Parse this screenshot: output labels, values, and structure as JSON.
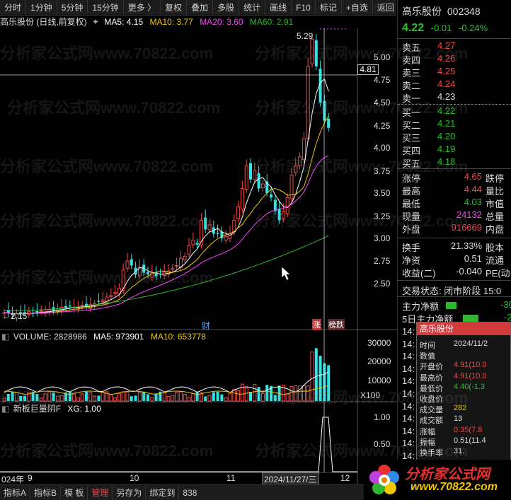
{
  "toolbar": {
    "items": [
      "分时",
      "1分钟",
      "5分钟",
      "15分钟",
      "更多 〉",
      "复权",
      "叠加",
      "多股",
      "统计",
      "画线",
      "F10",
      "标记",
      "+自选",
      "返回"
    ]
  },
  "chart_header": {
    "stock": "高乐股份 (日线,前复权)",
    "ma5": "MA5: 4.15",
    "ma10": "MA10: 3.77",
    "ma20": "MA20: 3.60",
    "ma60": "MA60: 2.91"
  },
  "price_axis": [
    "5.00",
    "4.75",
    "4.50",
    "4.25",
    "4.00",
    "3.75",
    "3.50",
    "3.25",
    "3.00",
    "2.75",
    "2.50"
  ],
  "annotations": {
    "high": "5.29",
    "low": "2.15",
    "crosshair_price": "4.81",
    "cai": "财",
    "zhang": "涨",
    "bang": "榜跌"
  },
  "volume_header": {
    "vol": "VOLUME: 2828986",
    "ma5": "MA5: 973901",
    "ma10": "MA10: 653778"
  },
  "volume_axis": [
    "30000",
    "20000",
    "10000"
  ],
  "volume_unit": "X100",
  "indicator_header": {
    "name": "新板巨量阴F",
    "xg": "XG: 1.00"
  },
  "indicator_axis": [
    "1.00",
    "0.50"
  ],
  "date_axis": {
    "d1": "024年",
    "d2": "9",
    "d3": "10",
    "d4": "11",
    "d5": "2024/11/27/三",
    "d6": "12"
  },
  "bottom_bar": [
    "指标A",
    "指标B",
    "模 板",
    "管理",
    "另存为",
    "绑定到",
    "838"
  ],
  "quote": {
    "name": "高乐股份",
    "code": "002348",
    "price": "4.22",
    "change": "-0.01",
    "pct": "-0.24%",
    "asks": [
      {
        "label": "卖五",
        "price": "4.27"
      },
      {
        "label": "卖四",
        "price": "4.26"
      },
      {
        "label": "卖三",
        "price": "4.25"
      },
      {
        "label": "卖二",
        "price": "4.24"
      },
      {
        "label": "卖一",
        "price": "4.23"
      }
    ],
    "bids": [
      {
        "label": "买一",
        "price": "4.22"
      },
      {
        "label": "买二",
        "price": "4.21"
      },
      {
        "label": "买三",
        "price": "4.20"
      },
      {
        "label": "买四",
        "price": "4.19"
      },
      {
        "label": "买五",
        "price": "4.18"
      }
    ],
    "stats": [
      {
        "l1": "涨停",
        "v1": "4.65",
        "l2": "跌停"
      },
      {
        "l1": "最高",
        "v1": "4.44",
        "l2": "量比"
      },
      {
        "l1": "最低",
        "v1": "4.03",
        "l2": "市值"
      },
      {
        "l1": "现量",
        "v1": "24132",
        "l2": "总量"
      },
      {
        "l1": "外盘",
        "v1": "916669",
        "l2": "内盘"
      }
    ],
    "stats2": [
      {
        "l1": "换手",
        "v1": "21.33%",
        "l2": "股本"
      },
      {
        "l1": "净资",
        "v1": "0.51",
        "l2": "流通"
      },
      {
        "l1": "收益(二)",
        "v1": "-0.040",
        "l2": "PE(动"
      }
    ],
    "trade_status_label": "交易状态:",
    "trade_status": "闭市阶段 15:0",
    "main_net": "主力净额",
    "main_net_val": "-30",
    "main_net5": "5日主力净额",
    "main_net5_val": "-2",
    "tick_times": [
      "14:",
      "14:",
      "14:",
      "14:",
      "14:",
      "14:",
      "14:",
      "14:",
      "14:",
      "14:",
      "14:",
      "14:",
      "14:",
      "14:",
      "14:"
    ]
  },
  "tooltip": {
    "title": "高乐股份",
    "rows": [
      {
        "k": "时间",
        "v": "2024/11/2"
      },
      {
        "k": "数值",
        "v": ""
      },
      {
        "k": "开盘价",
        "v": "4.91(10.0"
      },
      {
        "k": "最高价",
        "v": "4.91(10.0"
      },
      {
        "k": "最低价",
        "v": "4.40(-1.3"
      },
      {
        "k": "收盘价",
        "v": ""
      },
      {
        "k": "成交量",
        "v": "282"
      },
      {
        "k": "成交额",
        "v": "13"
      },
      {
        "k": "涨幅",
        "v": "0.35(7.8"
      },
      {
        "k": "振幅",
        "v": "0.51(11.4"
      },
      {
        "k": "换手率",
        "v": "31."
      }
    ]
  },
  "logo": {
    "text": "分析家公式网",
    "url": "www.70822.com"
  },
  "watermark": "分析家公式网www.70822.com",
  "colors": {
    "up": "#f04848",
    "down": "#2ee6e6",
    "ma5": "#ffffff",
    "ma10": "#f0c800",
    "ma20": "#ff40ff",
    "ma60": "#2fb82f"
  }
}
